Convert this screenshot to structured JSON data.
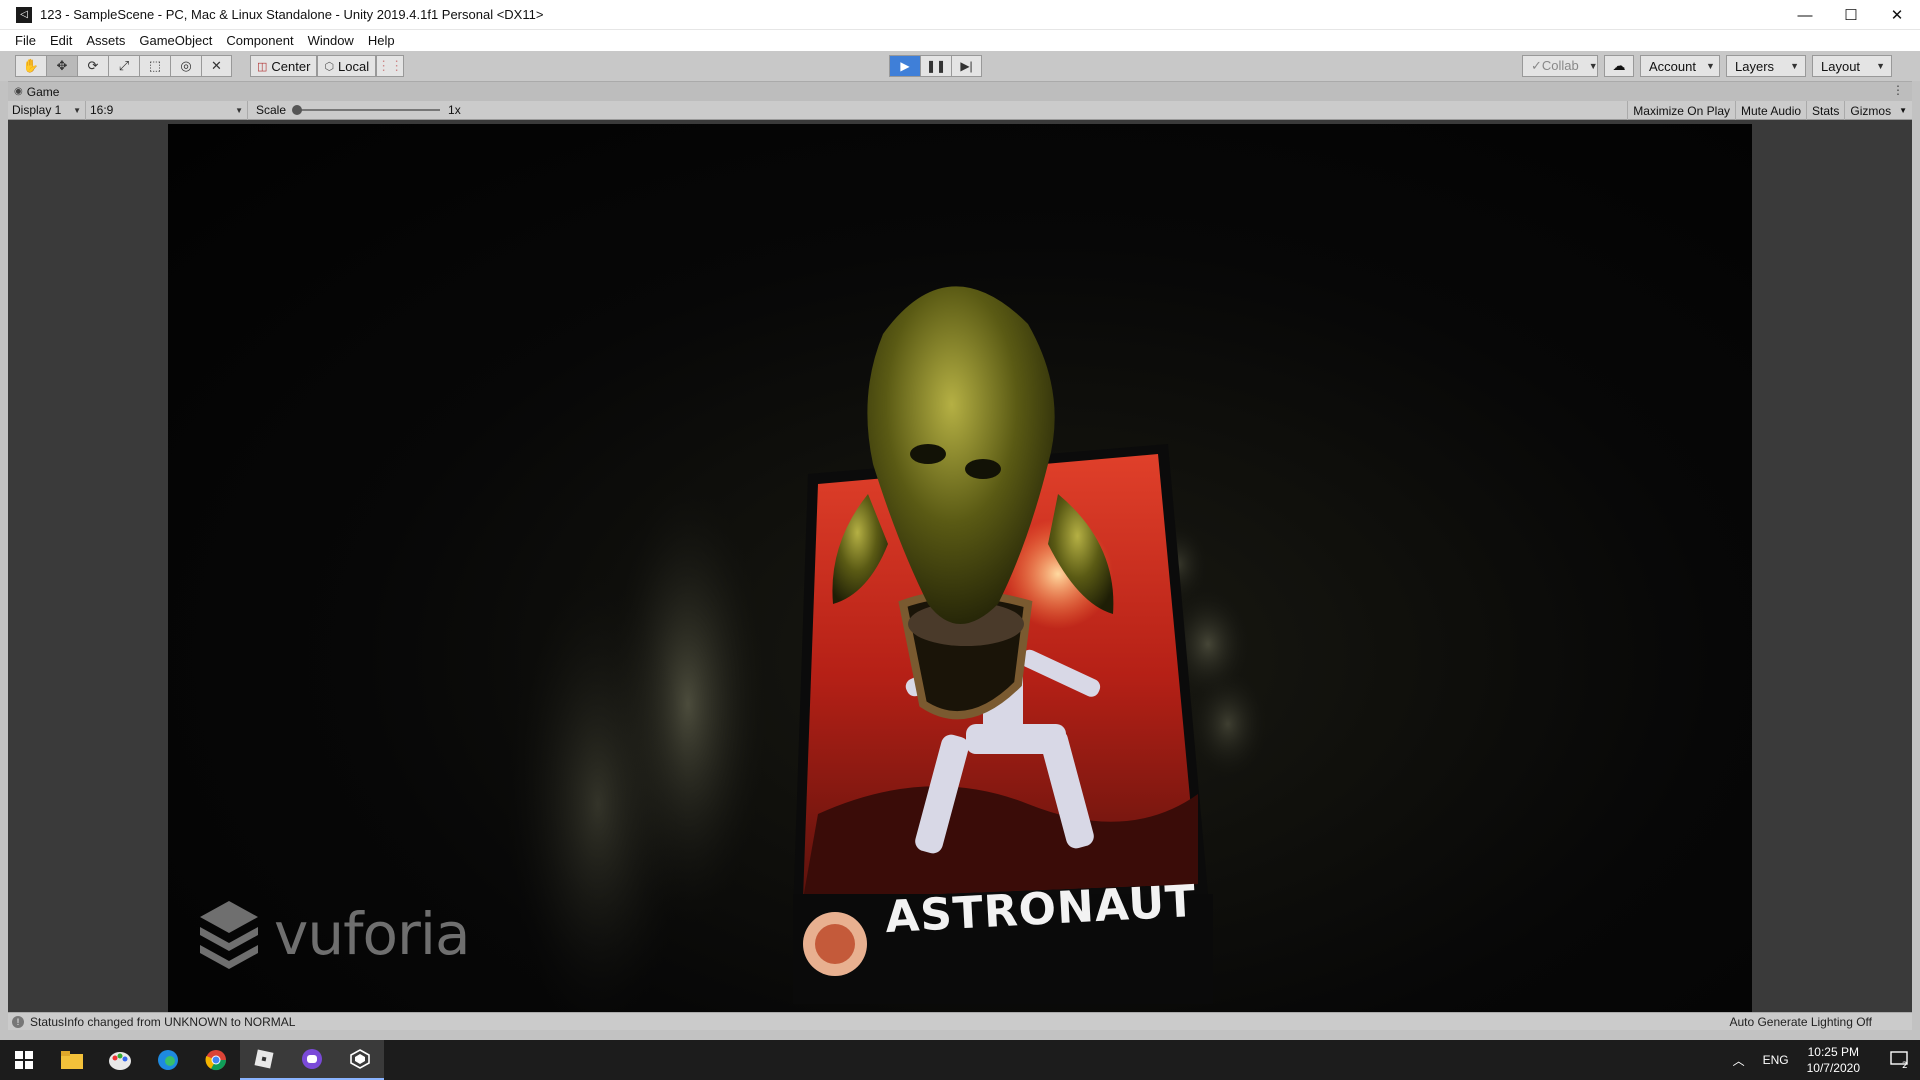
{
  "window": {
    "title": "123 - SampleScene - PC, Mac & Linux Standalone - Unity 2019.4.1f1 Personal <DX11>",
    "minimize": "—",
    "maximize": "☐",
    "close": "✕"
  },
  "menu": [
    "File",
    "Edit",
    "Assets",
    "GameObject",
    "Component",
    "Window",
    "Help"
  ],
  "toolbar": {
    "tools": [
      "hand-tool",
      "move-tool",
      "rotate-tool",
      "scale-tool",
      "rect-tool",
      "transform-tool",
      "custom-tool"
    ],
    "pivot": "Center",
    "rotation": "Local",
    "collab": "Collab",
    "account": "Account",
    "layers": "Layers",
    "layout": "Layout"
  },
  "game": {
    "tab": "Game",
    "display": "Display 1",
    "aspect": "16:9",
    "scale_label": "Scale",
    "scale_value": "1x",
    "maximize_on_play": "Maximize On Play",
    "mute_audio": "Mute Audio",
    "stats": "Stats",
    "gizmos": "Gizmos",
    "logo_text": "vuforia",
    "card_title": "ASTRONAUT"
  },
  "status": {
    "message": "StatusInfo changed from UNKNOWN to NORMAL",
    "lighting": "Auto Generate Lighting Off"
  },
  "taskbar": {
    "apps": [
      "start-button",
      "file-explorer",
      "paint-app",
      "edge-browser",
      "chrome-browser",
      "roblox-app",
      "discord-app",
      "unity-app"
    ],
    "language": "ENG",
    "time": "10:25 PM",
    "date": "10/7/2020",
    "notifications": "2"
  },
  "colors": {
    "play_active": "#3f7fd8",
    "cactus": "#6a6a1a",
    "card_red": "#c8281a"
  }
}
